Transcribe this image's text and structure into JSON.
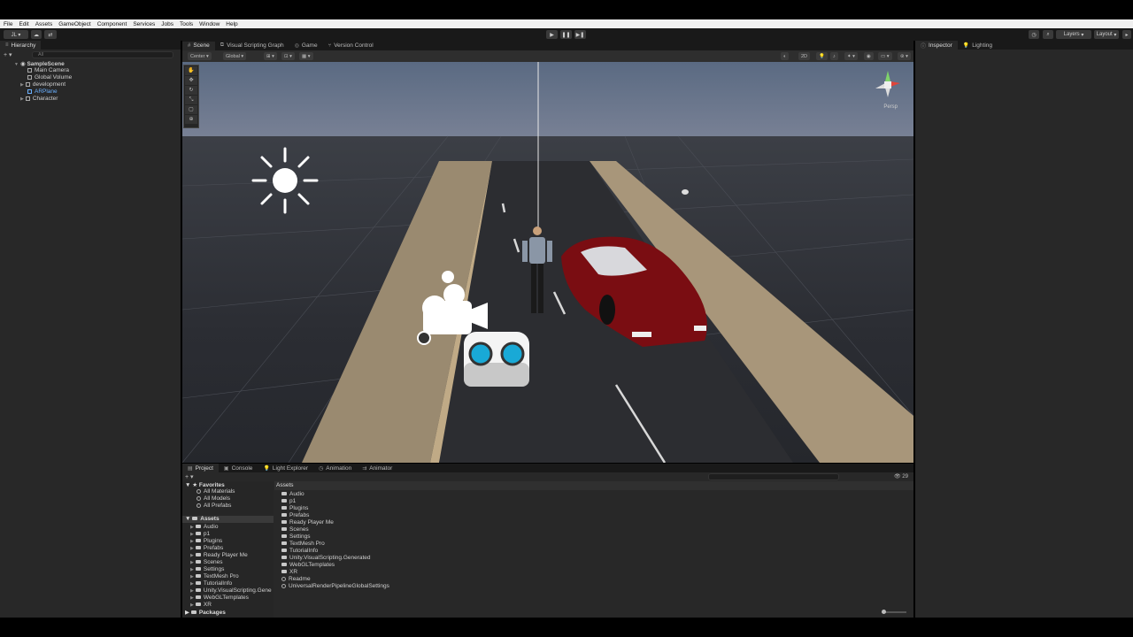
{
  "menu": [
    "File",
    "Edit",
    "Assets",
    "GameObject",
    "Component",
    "Services",
    "Jobs",
    "Tools",
    "Window",
    "Help"
  ],
  "toolbar": {
    "account_label": "JL ▾",
    "layers_label": "Layers",
    "layout_label": "Layout"
  },
  "hierarchy": {
    "tab_label": "Hierarchy",
    "search_placeholder": "All",
    "scene": "SampleScene",
    "items": [
      "Main Camera",
      "Global Volume",
      "development",
      "ARPlane",
      "Character"
    ]
  },
  "scene_tabs": [
    "Scene",
    "Visual Scripting Graph",
    "Game",
    "Version Control"
  ],
  "scene_toolbar": {
    "pivot": "Center",
    "space": "Global",
    "mode_2d": "2D",
    "view_label": "Persp"
  },
  "right_tabs": [
    "Inspector",
    "Lighting"
  ],
  "bottom_tabs": [
    "Project",
    "Console",
    "Light Explorer",
    "Animation",
    "Animator"
  ],
  "project": {
    "favorites_label": "Favorites",
    "favorites": [
      "All Materials",
      "All Models",
      "All Prefabs"
    ],
    "assets_label": "Assets",
    "tree": [
      "Audio",
      "p1",
      "Plugins",
      "Prefabs",
      "Ready Player Me",
      "Scenes",
      "Settings",
      "TextMesh Pro",
      "TutorialInfo",
      "Unity.VisualScripting.Gene",
      "WebGLTemplates",
      "XR"
    ],
    "packages_label": "Packages",
    "breadcrumb": "Assets",
    "folders": [
      "Audio",
      "p1",
      "Plugins",
      "Prefabs",
      "Ready Player Me",
      "Scenes",
      "Settings",
      "TextMesh Pro",
      "TutorialInfo",
      "Unity.VisualScripting.Generated",
      "WebGLTemplates",
      "XR"
    ],
    "files": [
      "Readme",
      "UniversalRenderPipelineGlobalSettings"
    ],
    "count": "29"
  }
}
